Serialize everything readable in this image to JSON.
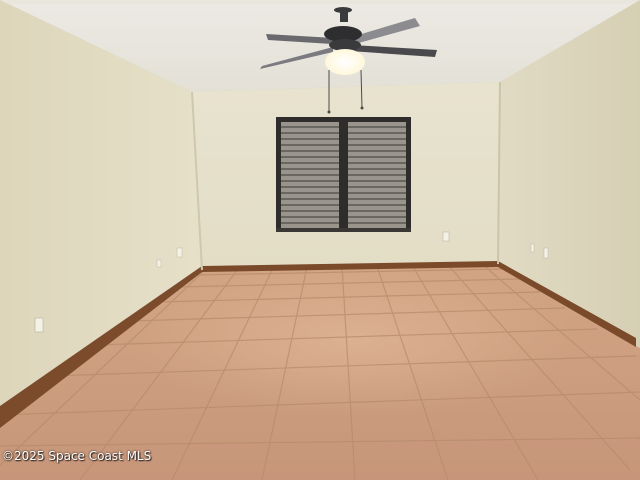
{
  "watermark": {
    "text": "©2025 Space Coast MLS"
  },
  "scene": {
    "description_colors": {
      "ceiling": "#eae8e0",
      "back_wall": "#e7e2cc",
      "left_wall": "#e2dcc4",
      "right_wall": "#ddd6bd",
      "floor_tile": "#c99a76",
      "grout": "#b88a68",
      "baseboard": "#7a4a2a",
      "window_frame": "#2f2d2b",
      "blinds": "#8f8a82",
      "fan_body": "#3a3a3c",
      "fan_light": "#fffdf4"
    }
  }
}
